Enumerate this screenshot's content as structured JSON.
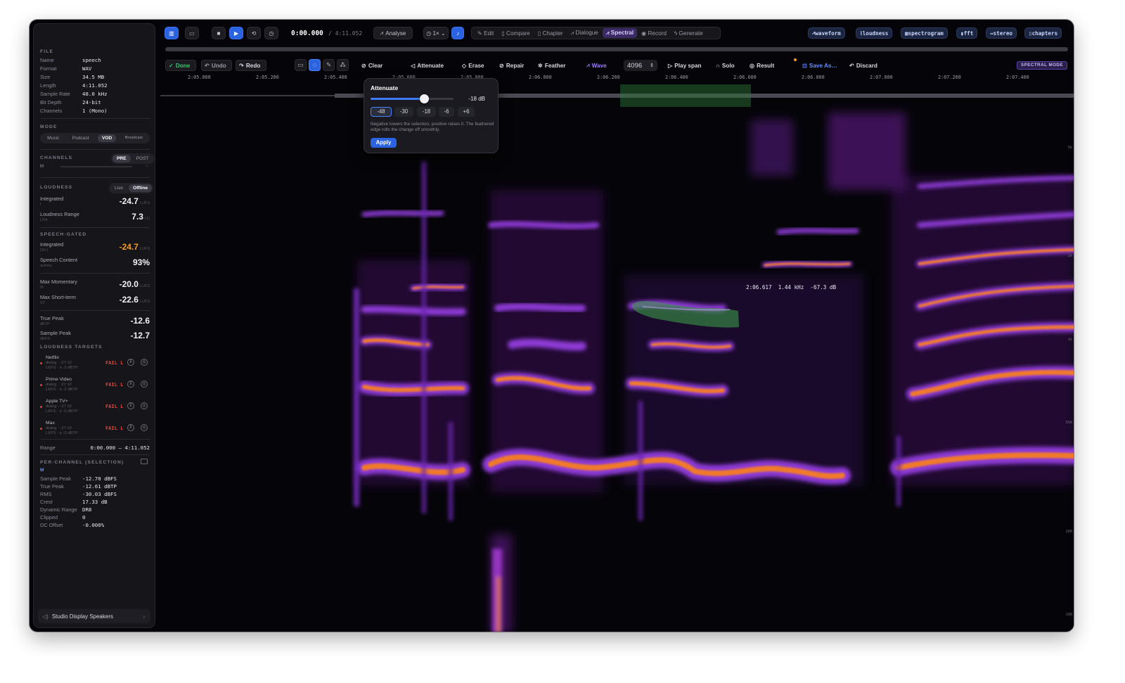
{
  "file": {
    "section": "FILE",
    "rows": [
      {
        "k": "Name",
        "v": "speech"
      },
      {
        "k": "Format",
        "v": "WAV"
      },
      {
        "k": "Size",
        "v": "34.5 MB"
      },
      {
        "k": "Length",
        "v": "4:11.052"
      },
      {
        "k": "Sample Rate",
        "v": "48.0 kHz"
      },
      {
        "k": "Bit Depth",
        "v": "24-bit"
      },
      {
        "k": "Channels",
        "v": "1 (Mono)"
      }
    ]
  },
  "mode": {
    "section": "MODE",
    "options": [
      "Music",
      "Podcast",
      "VOD",
      "Broadcast"
    ],
    "selected": "VOD"
  },
  "channels": {
    "section": "CHANNELS",
    "pre": "PRE",
    "post": "POST",
    "label": "M",
    "arrow": "→"
  },
  "loudness": {
    "section": "LOUDNESS",
    "live": "Live",
    "offline": "Offline",
    "integrated": {
      "label": "Integrated",
      "sub": "I",
      "value": "-24.7",
      "unit": "LUFS"
    },
    "range": {
      "label": "Loudness Range",
      "sub": "LRA",
      "value": "7.3",
      "unit": "LU"
    }
  },
  "speech_gated": {
    "section": "SPEECH-GATED",
    "integrated": {
      "label": "Integrated",
      "sub": "DR-I",
      "value": "-24.7",
      "unit": "LUFS"
    },
    "content": {
      "label": "Speech Content",
      "sub": "activity",
      "value": "93%"
    }
  },
  "max": {
    "momentary": {
      "label": "Max Momentary",
      "sub": "M",
      "value": "-20.0",
      "unit": "LUFS"
    },
    "short": {
      "label": "Max Short-term",
      "sub": "ST",
      "value": "-22.6",
      "unit": "LUFS"
    }
  },
  "peaks": {
    "true_peak": {
      "label": "True Peak",
      "sub": "dBTP",
      "value": "-12.6"
    },
    "sample_peak": {
      "label": "Sample Peak",
      "sub": "dBFS",
      "value": "-12.7"
    }
  },
  "targets": {
    "section": "LOUDNESS TARGETS",
    "items": [
      {
        "name": "Netflix",
        "d1": "dialog · -27 ±2",
        "d2": "LKFS · ≤ -2 dBTP",
        "status": "FAIL L"
      },
      {
        "name": "Prime Video",
        "d1": "dialog · -27 ±2",
        "d2": "LKFS · ≤ -2 dBTP",
        "status": "FAIL L"
      },
      {
        "name": "Apple TV+",
        "d1": "dialog · -27 ±2",
        "d2": "LKFS · ≤ -2 dBTP",
        "status": "FAIL L"
      },
      {
        "name": "Max",
        "d1": "dialog · -27 ±2",
        "d2": "LKFS · ≤ -2 dBTP",
        "status": "FAIL L"
      }
    ]
  },
  "range_row": {
    "label": "Range",
    "value": "0:00.000 – 4:11.052"
  },
  "per_channel": {
    "section": "PER-CHANNEL (SELECTION)",
    "channel": "M",
    "rows": [
      {
        "k": "Sample Peak",
        "v": "-12.70 dBFS"
      },
      {
        "k": "True Peak",
        "v": "-12.61 dBTP"
      },
      {
        "k": "RMS",
        "v": "-30.03 dBFS"
      },
      {
        "k": "Crest",
        "v": "17.33 dB"
      },
      {
        "k": "Dynamic Range",
        "v": "DR8"
      },
      {
        "k": "Clipped",
        "v": "0"
      },
      {
        "k": "DC Offset",
        "v": "-0.000%"
      }
    ]
  },
  "output": {
    "label": "Studio Display Speakers"
  },
  "toolbar": {
    "time_current": "0:00.000",
    "time_total": "/ 4:11.052",
    "analyse": "Analyse",
    "speed": "1×",
    "tabs": [
      "Edit",
      "Compare",
      "Chapter",
      "Dialogue",
      "Spectral",
      "Record",
      "Generate"
    ],
    "active_tab": "Spectral",
    "views": [
      "waveform",
      "loudness",
      "spectrogram",
      "fft",
      "stereo",
      "chapters"
    ]
  },
  "spectral_tools": {
    "done": "Done",
    "undo": "Undo",
    "redo": "Redo",
    "clear": "Clear",
    "attenuate": "Attenuate",
    "erase": "Erase",
    "repair": "Repair",
    "feather": "Feather",
    "wave": "Wave",
    "fft_size": "4096",
    "play_span": "Play span",
    "solo": "Solo",
    "result": "Result",
    "save_as": "Save As…",
    "discard": "Discard",
    "mode_badge": "SPECTRAL MODE"
  },
  "ruler": {
    "ticks": [
      "2:05.000",
      "2:05.200",
      "2:05.400",
      "2:05.600",
      "2:05.800",
      "2:06.000",
      "2:06.200",
      "2:06.400",
      "2:06.600",
      "2:06.800",
      "2:07.000",
      "2:07.200",
      "2:07.400"
    ]
  },
  "freq_axis": [
    "5k",
    "2k",
    "1k",
    "500",
    "200",
    "100"
  ],
  "cursor_readout": "2:06.617  1.44 kHz  -67.3 dB",
  "attenuate_popover": {
    "title": "Attenuate",
    "value_label": "-18 dB",
    "slider_fraction": 0.64,
    "presets": [
      "-48",
      "-30",
      "-18",
      "-6",
      "+6"
    ],
    "selected_preset": "-48",
    "help": "Negative lowers the selection, positive raises it. The feathered edge rolls the change off smoothly.",
    "apply": "Apply"
  },
  "colors": {
    "accent": "#2a62e0",
    "spectral": "#8b5cf6",
    "fail": "#e0433c",
    "warn": "#f39a2a"
  }
}
